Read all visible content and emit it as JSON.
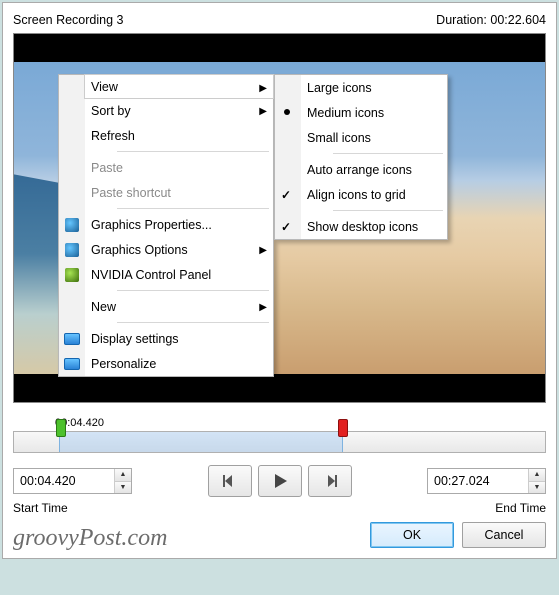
{
  "header": {
    "title": "Screen Recording 3",
    "duration_label": "Duration:",
    "duration_value": "00:22.604"
  },
  "context_menu": {
    "view": "View",
    "sort_by": "Sort by",
    "refresh": "Refresh",
    "paste": "Paste",
    "paste_shortcut": "Paste shortcut",
    "graphics_properties": "Graphics Properties...",
    "graphics_options": "Graphics Options",
    "nvidia": "NVIDIA Control Panel",
    "new": "New",
    "display_settings": "Display settings",
    "personalize": "Personalize"
  },
  "view_submenu": {
    "large": "Large icons",
    "medium": "Medium icons",
    "small": "Small icons",
    "auto_arrange": "Auto arrange icons",
    "align_grid": "Align icons to grid",
    "show_desktop": "Show desktop icons"
  },
  "timeline": {
    "start_tick": "00:04.420",
    "start_value": "00:04.420",
    "end_value": "00:27.024",
    "start_label": "Start Time",
    "end_label": "End Time",
    "duration_seconds": 22.604,
    "start_seconds": 4.42,
    "selection_end_percent": 62
  },
  "footer": {
    "ok": "OK",
    "cancel": "Cancel"
  },
  "watermark": "groovyPost.com"
}
